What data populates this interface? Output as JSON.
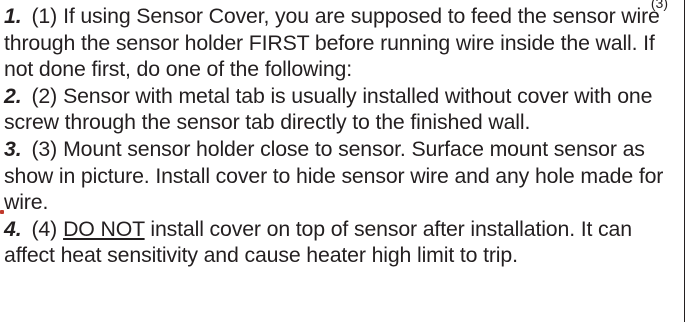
{
  "header_fragment": "(3)",
  "instructions": [
    {
      "number": "1.",
      "paren": "(1)",
      "text": "If using Sensor Cover, you are supposed to feed the sensor wire through the sensor holder FIRST before running wire inside the wall. If not done first, do one of the following:"
    },
    {
      "number": "2.",
      "paren": "(2)",
      "text": "Sensor with metal tab is usually installed without cover with one screw through the sensor tab directly to the finished wall."
    },
    {
      "number": "3.",
      "paren": "(3)",
      "text": "Mount sensor holder close to sensor. Surface mount sensor as show in picture. Install cover to hide sensor wire and any hole made for wire."
    },
    {
      "number": "4.",
      "paren": "(4)",
      "emphasis": "DO NOT",
      "text": " install cover on top of sensor after installation. It can affect heat sensitivity and cause heater high limit to trip."
    }
  ]
}
